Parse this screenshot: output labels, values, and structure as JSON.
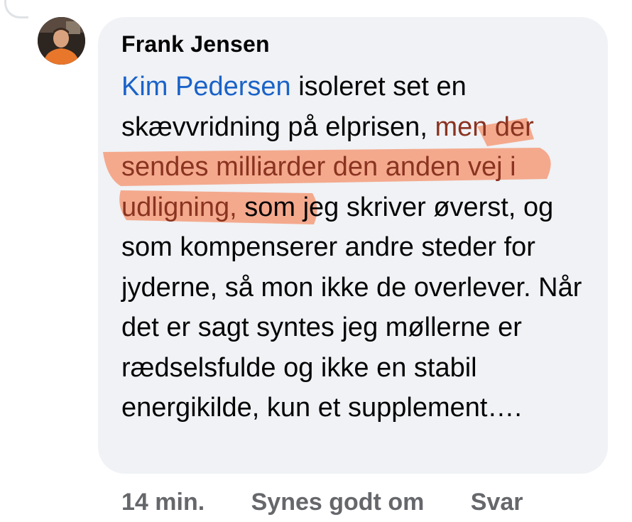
{
  "comment": {
    "author": "Frank Jensen",
    "mention": "Kim Pedersen",
    "text_before_highlight": " isoleret set en skævvridning på elprisen, ",
    "highlighted_text": "men der sendes milliarder den anden vej i udligning,",
    "text_after_highlight": " som jeg skriver øverst, og som kompenserer andre steder for jyderne, så mon ikke de overlever. Når det er sagt syntes jeg møllerne er rædselsfulde og ikke en stabil energikilde, kun et supplement….",
    "timestamp": "14 min.",
    "like_label": "Synes godt om",
    "reply_label": "Svar"
  },
  "colors": {
    "bubble_background": "#f0f2f5",
    "mention": "#1a62c8",
    "highlight_marker": "#f4a182",
    "action_text": "#65676b"
  }
}
